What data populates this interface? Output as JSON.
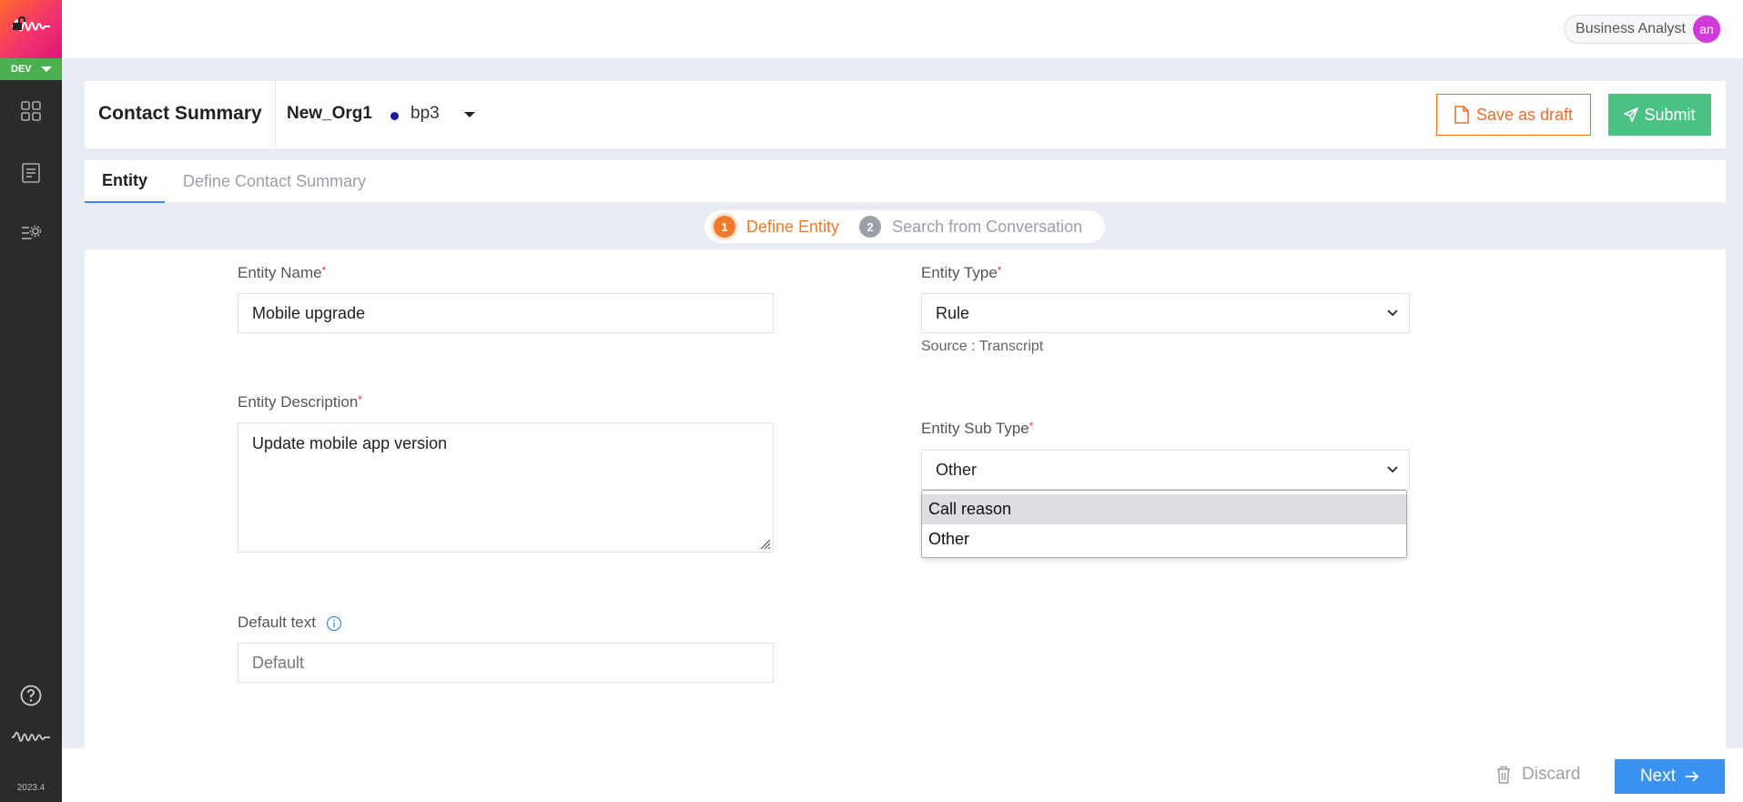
{
  "app": {
    "env": "DEV",
    "version": "2023.4"
  },
  "user": {
    "role": "Business Analyst",
    "initials": "an"
  },
  "header": {
    "title": "Contact Summary",
    "org": "New_Org1",
    "bp": "bp3",
    "save_draft_label": "Save as draft",
    "submit_label": "Submit"
  },
  "tabs": [
    {
      "label": "Entity",
      "active": true
    },
    {
      "label": "Define Contact Summary",
      "active": false
    }
  ],
  "stepper": [
    {
      "num": "1",
      "label": "Define Entity",
      "active": true
    },
    {
      "num": "2",
      "label": "Search from Conversation",
      "active": false
    }
  ],
  "form": {
    "entity_name": {
      "label": "Entity Name",
      "required": "*",
      "value": "Mobile upgrade"
    },
    "entity_description": {
      "label": "Entity Description",
      "required": "*",
      "value": "Update mobile app version"
    },
    "default_text": {
      "label": "Default text",
      "placeholder": "Default"
    },
    "entity_type": {
      "label": "Entity Type",
      "required": "*",
      "value": "Rule",
      "hint": "Source : Transcript"
    },
    "entity_sub_type": {
      "label": "Entity Sub Type",
      "required": "*",
      "value": "Other",
      "options": [
        "Call reason",
        "Other"
      ]
    }
  },
  "footer": {
    "discard_label": "Discard",
    "next_label": "Next"
  },
  "colors": {
    "accent_orange": "#f07a2a",
    "submit_green": "#4ac283",
    "next_blue": "#3a92f0",
    "env_green": "#4caf50"
  }
}
